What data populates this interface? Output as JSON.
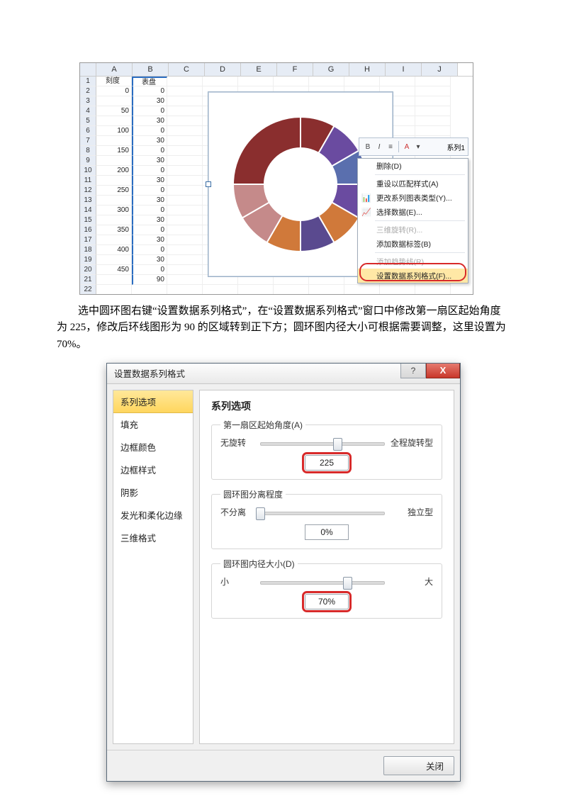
{
  "excel": {
    "col_letters": [
      "A",
      "B",
      "C",
      "D",
      "E",
      "F",
      "G",
      "H",
      "I",
      "J"
    ],
    "headers": {
      "A": "刻度",
      "B": "表盘"
    },
    "rows": [
      {
        "n": 2,
        "A": "0",
        "B": "0"
      },
      {
        "n": 3,
        "A": "",
        "B": "30"
      },
      {
        "n": 4,
        "A": "50",
        "B": "0"
      },
      {
        "n": 5,
        "A": "",
        "B": "30"
      },
      {
        "n": 6,
        "A": "100",
        "B": "0"
      },
      {
        "n": 7,
        "A": "",
        "B": "30"
      },
      {
        "n": 8,
        "A": "150",
        "B": "0"
      },
      {
        "n": 9,
        "A": "",
        "B": "30"
      },
      {
        "n": 10,
        "A": "200",
        "B": "0"
      },
      {
        "n": 11,
        "A": "",
        "B": "30"
      },
      {
        "n": 12,
        "A": "250",
        "B": "0"
      },
      {
        "n": 13,
        "A": "",
        "B": "30"
      },
      {
        "n": 14,
        "A": "300",
        "B": "0"
      },
      {
        "n": 15,
        "A": "",
        "B": "30"
      },
      {
        "n": 16,
        "A": "350",
        "B": "0"
      },
      {
        "n": 17,
        "A": "",
        "B": "30"
      },
      {
        "n": 18,
        "A": "400",
        "B": "0"
      },
      {
        "n": 19,
        "A": "",
        "B": "30"
      },
      {
        "n": 20,
        "A": "450",
        "B": "0"
      },
      {
        "n": 21,
        "A": "",
        "B": "90"
      }
    ],
    "last_row": 22
  },
  "minibar": {
    "series_label": "系列1",
    "bold": "B",
    "italic": "I"
  },
  "context_menu": {
    "items": [
      {
        "label": "删除(D)",
        "disabled": false
      },
      {
        "label": "重设以匹配样式(A)",
        "disabled": false
      },
      {
        "label": "更改系列图表类型(Y)...",
        "disabled": false
      },
      {
        "label": "选择数据(E)...",
        "disabled": false
      },
      {
        "label": "三维旋转(R)...",
        "disabled": true
      },
      {
        "label": "添加数据标签(B)",
        "disabled": false
      },
      {
        "label": "添加趋势线(R)...",
        "disabled": true
      },
      {
        "label": "设置数据系列格式(F)...",
        "disabled": false,
        "highlight": true
      }
    ]
  },
  "paragraph": "选中圆环图右键“设置数据系列格式”，在“设置数据系列格式”窗口中修改第一扇区起始角度为 225，修改后环线图形为 90 的区域转到正下方；圆环图内径大小可根据需要调整，这里设置为 70%。",
  "dialog": {
    "title": "设置数据系列格式",
    "help": "?",
    "close_x": "X",
    "nav": [
      "系列选项",
      "填充",
      "边框颜色",
      "边框样式",
      "阴影",
      "发光和柔化边缘",
      "三维格式"
    ],
    "main_heading": "系列选项",
    "group1": {
      "legend": "第一扇区起始角度(A)",
      "left": "无旋转",
      "right": "全程旋转型",
      "value": "225",
      "thumb_pct": 62
    },
    "group2": {
      "legend": "圆环图分离程度",
      "left": "不分离",
      "right": "独立型",
      "value": "0%",
      "thumb_pct": 0
    },
    "group3": {
      "legend": "圆环图内径大小(D)",
      "left": "小",
      "right": "大",
      "value": "70%",
      "thumb_pct": 70
    },
    "close_btn": "关闭"
  },
  "chart_data": {
    "type": "pie",
    "title": "",
    "series": [
      {
        "name": "表盘",
        "values": [
          0,
          30,
          0,
          30,
          0,
          30,
          0,
          30,
          0,
          30,
          0,
          30,
          0,
          30,
          0,
          30,
          0,
          30,
          0,
          90
        ]
      }
    ],
    "hole_size_pct": 70,
    "first_slice_angle": 0,
    "slice_colors": [
      "#8a2e2e",
      "#6a4ba0",
      "#5a6fae",
      "#6a4ba0",
      "#d0793a",
      "#5a4a8f",
      "#d0793a",
      "#c58a8a",
      "#c58a8a"
    ]
  }
}
